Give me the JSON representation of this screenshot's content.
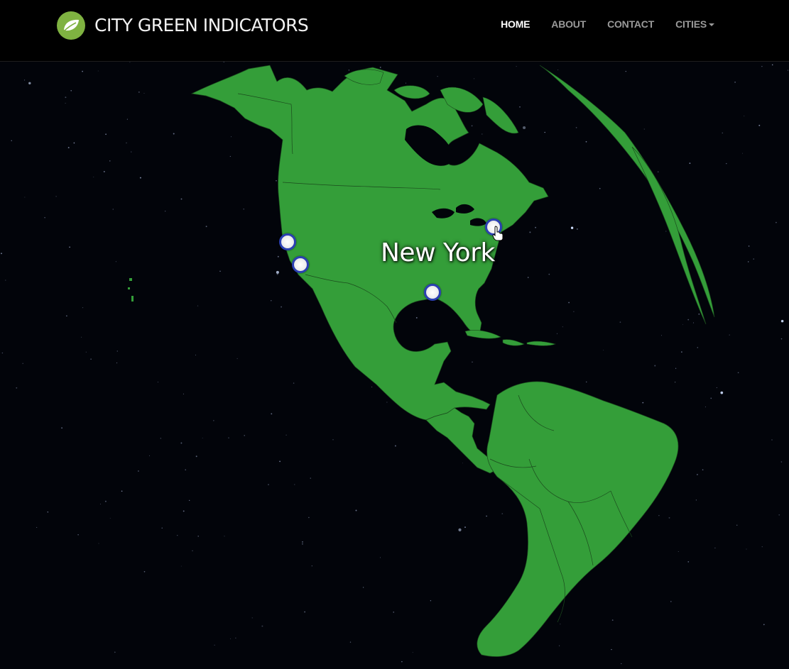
{
  "header": {
    "brand": "CITY GREEN INDICATORS",
    "nav": [
      {
        "label": "HOME",
        "active": true
      },
      {
        "label": "ABOUT",
        "active": false
      },
      {
        "label": "CONTACT",
        "active": false
      },
      {
        "label": "CITIES",
        "active": false,
        "dropdown": true
      }
    ]
  },
  "globe": {
    "hover_label": "New York",
    "land_color": "#349e39",
    "border_color": "#1b4b1d",
    "background": "#02040a",
    "marker_fill": "#ffffff",
    "marker_ring": "#2b3fb3",
    "marker_count": 4
  },
  "icons": {
    "logo": "leaf-icon",
    "pointer": "hand-pointer-icon"
  }
}
